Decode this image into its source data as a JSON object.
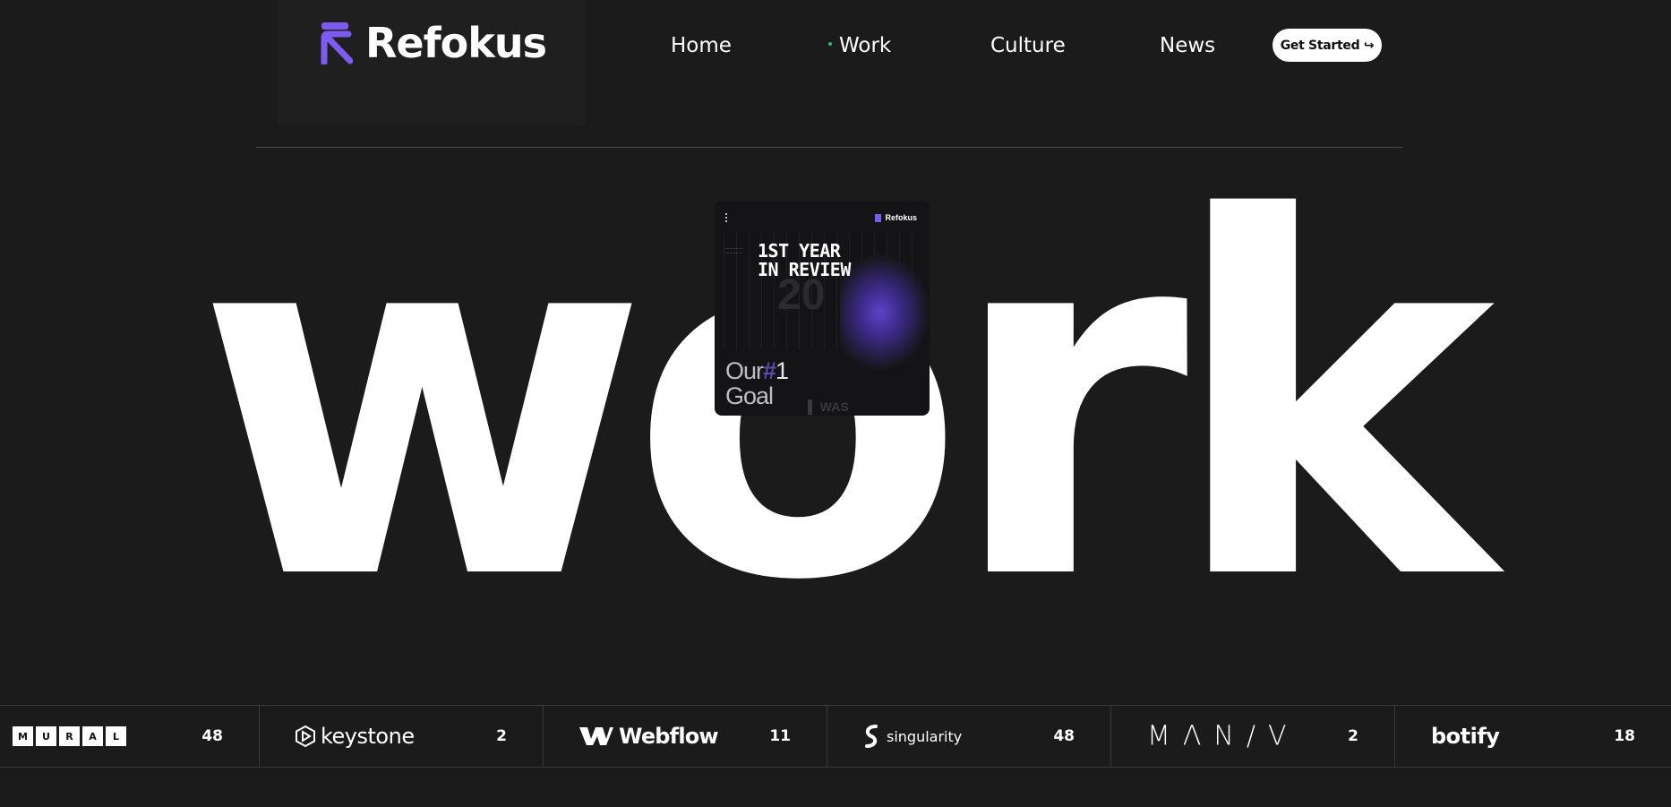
{
  "header": {
    "brand": "Refokus",
    "nav": [
      {
        "label": "Home"
      },
      {
        "label": "Work",
        "active": true
      },
      {
        "label": "Culture"
      },
      {
        "label": "News"
      }
    ],
    "cta_label": "Get Started ↪"
  },
  "hero": {
    "word": "work",
    "preview": {
      "brand": "Refokus",
      "headline_line1": "1ST YEAR",
      "headline_line2": "IN REVIEW",
      "ghost": "20",
      "goal_prefix": "Our",
      "goal_hash": "#",
      "goal_num": "1",
      "goal_line2": "Goal",
      "was": "▌ WAS"
    }
  },
  "clients": [
    {
      "name": "MURAL",
      "letters": [
        "M",
        "U",
        "R",
        "A",
        "L"
      ],
      "count": "48"
    },
    {
      "name": "keystone",
      "count": "2"
    },
    {
      "name": "Webflow",
      "count": "11"
    },
    {
      "name": "singularity",
      "count": "48"
    },
    {
      "name": "MANIV",
      "display": "MΛN/V",
      "count": "2"
    },
    {
      "name": "botify",
      "count": "18"
    }
  ],
  "colors": {
    "background": "#1b1b1c",
    "accent": "#7c5cf0",
    "active_dot": "#22c55e",
    "text": "#ffffff"
  }
}
